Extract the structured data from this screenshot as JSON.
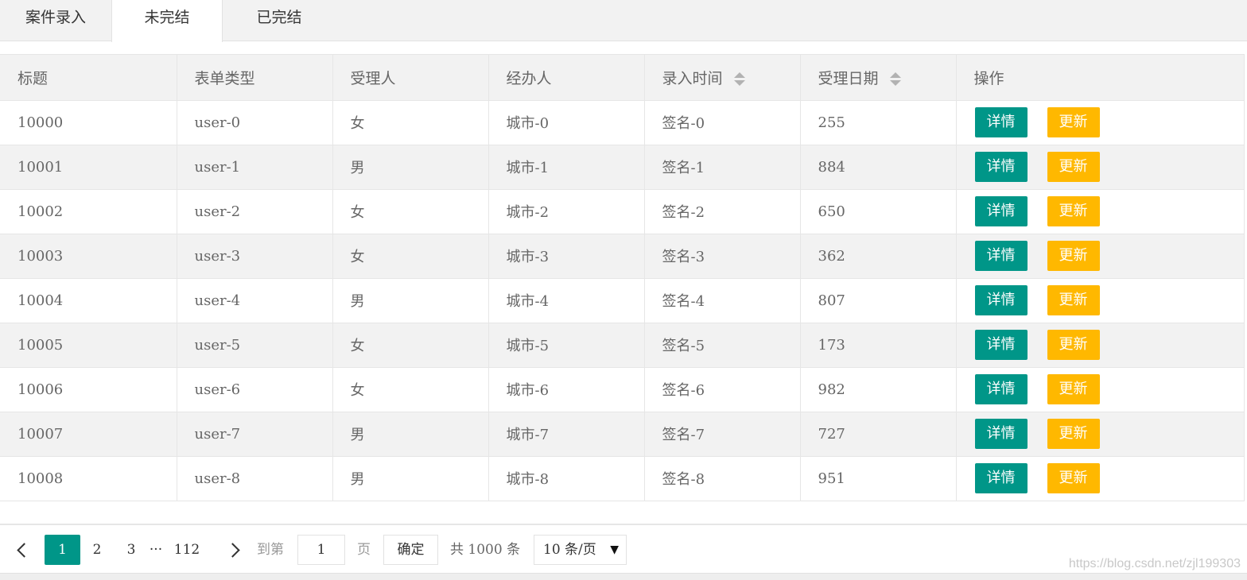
{
  "tabs": [
    "案件录入",
    "未完结",
    "已完结"
  ],
  "table": {
    "headers": [
      "标题",
      "表单类型",
      "受理人",
      "经办人",
      "录入时间",
      "受理日期",
      "操作"
    ],
    "rows": [
      [
        "10000",
        "user-0",
        "女",
        "城市-0",
        "签名-0",
        "255"
      ],
      [
        "10001",
        "user-1",
        "男",
        "城市-1",
        "签名-1",
        "884"
      ],
      [
        "10002",
        "user-2",
        "女",
        "城市-2",
        "签名-2",
        "650"
      ],
      [
        "10003",
        "user-3",
        "女",
        "城市-3",
        "签名-3",
        "362"
      ],
      [
        "10004",
        "user-4",
        "男",
        "城市-4",
        "签名-4",
        "807"
      ],
      [
        "10005",
        "user-5",
        "女",
        "城市-5",
        "签名-5",
        "173"
      ],
      [
        "10006",
        "user-6",
        "女",
        "城市-6",
        "签名-6",
        "982"
      ],
      [
        "10007",
        "user-7",
        "男",
        "城市-7",
        "签名-7",
        "727"
      ],
      [
        "10008",
        "user-8",
        "男",
        "城市-8",
        "签名-8",
        "951"
      ]
    ],
    "detail_label": "详情",
    "update_label": "更新"
  },
  "pager": {
    "current": "1",
    "pages": [
      "2",
      "3"
    ],
    "ellipsis": "···",
    "last": "112",
    "goto_label": "到第",
    "goto_value": "1",
    "page_unit": "页",
    "confirm_label": "确定",
    "total": "共 1000 条",
    "limit": "10 条/页"
  },
  "watermark": "https://blog.csdn.net/zjl199303",
  "colors": {
    "primary": "#009688",
    "warm": "#ffb800"
  },
  "icons": {
    "prev": "chevron-left-icon",
    "next": "chevron-right-icon",
    "sort": "sort-icon",
    "caret": "caret-down-icon"
  }
}
